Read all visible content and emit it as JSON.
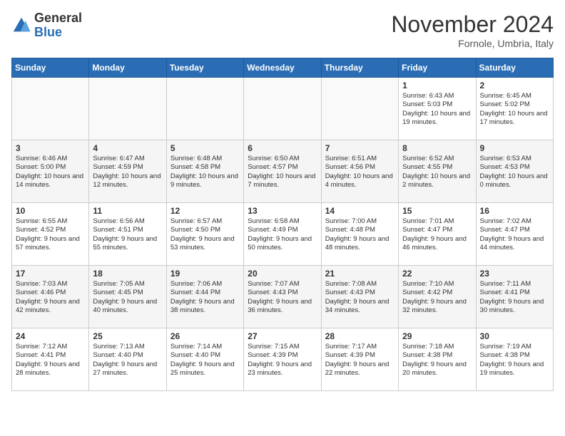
{
  "header": {
    "logo_general": "General",
    "logo_blue": "Blue",
    "month_title": "November 2024",
    "location": "Fornole, Umbria, Italy"
  },
  "days_of_week": [
    "Sunday",
    "Monday",
    "Tuesday",
    "Wednesday",
    "Thursday",
    "Friday",
    "Saturday"
  ],
  "weeks": [
    [
      {
        "day": "",
        "content": ""
      },
      {
        "day": "",
        "content": ""
      },
      {
        "day": "",
        "content": ""
      },
      {
        "day": "",
        "content": ""
      },
      {
        "day": "",
        "content": ""
      },
      {
        "day": "1",
        "content": "Sunrise: 6:43 AM\nSunset: 5:03 PM\nDaylight: 10 hours and 19 minutes."
      },
      {
        "day": "2",
        "content": "Sunrise: 6:45 AM\nSunset: 5:02 PM\nDaylight: 10 hours and 17 minutes."
      }
    ],
    [
      {
        "day": "3",
        "content": "Sunrise: 6:46 AM\nSunset: 5:00 PM\nDaylight: 10 hours and 14 minutes."
      },
      {
        "day": "4",
        "content": "Sunrise: 6:47 AM\nSunset: 4:59 PM\nDaylight: 10 hours and 12 minutes."
      },
      {
        "day": "5",
        "content": "Sunrise: 6:48 AM\nSunset: 4:58 PM\nDaylight: 10 hours and 9 minutes."
      },
      {
        "day": "6",
        "content": "Sunrise: 6:50 AM\nSunset: 4:57 PM\nDaylight: 10 hours and 7 minutes."
      },
      {
        "day": "7",
        "content": "Sunrise: 6:51 AM\nSunset: 4:56 PM\nDaylight: 10 hours and 4 minutes."
      },
      {
        "day": "8",
        "content": "Sunrise: 6:52 AM\nSunset: 4:55 PM\nDaylight: 10 hours and 2 minutes."
      },
      {
        "day": "9",
        "content": "Sunrise: 6:53 AM\nSunset: 4:53 PM\nDaylight: 10 hours and 0 minutes."
      }
    ],
    [
      {
        "day": "10",
        "content": "Sunrise: 6:55 AM\nSunset: 4:52 PM\nDaylight: 9 hours and 57 minutes."
      },
      {
        "day": "11",
        "content": "Sunrise: 6:56 AM\nSunset: 4:51 PM\nDaylight: 9 hours and 55 minutes."
      },
      {
        "day": "12",
        "content": "Sunrise: 6:57 AM\nSunset: 4:50 PM\nDaylight: 9 hours and 53 minutes."
      },
      {
        "day": "13",
        "content": "Sunrise: 6:58 AM\nSunset: 4:49 PM\nDaylight: 9 hours and 50 minutes."
      },
      {
        "day": "14",
        "content": "Sunrise: 7:00 AM\nSunset: 4:48 PM\nDaylight: 9 hours and 48 minutes."
      },
      {
        "day": "15",
        "content": "Sunrise: 7:01 AM\nSunset: 4:47 PM\nDaylight: 9 hours and 46 minutes."
      },
      {
        "day": "16",
        "content": "Sunrise: 7:02 AM\nSunset: 4:47 PM\nDaylight: 9 hours and 44 minutes."
      }
    ],
    [
      {
        "day": "17",
        "content": "Sunrise: 7:03 AM\nSunset: 4:46 PM\nDaylight: 9 hours and 42 minutes."
      },
      {
        "day": "18",
        "content": "Sunrise: 7:05 AM\nSunset: 4:45 PM\nDaylight: 9 hours and 40 minutes."
      },
      {
        "day": "19",
        "content": "Sunrise: 7:06 AM\nSunset: 4:44 PM\nDaylight: 9 hours and 38 minutes."
      },
      {
        "day": "20",
        "content": "Sunrise: 7:07 AM\nSunset: 4:43 PM\nDaylight: 9 hours and 36 minutes."
      },
      {
        "day": "21",
        "content": "Sunrise: 7:08 AM\nSunset: 4:43 PM\nDaylight: 9 hours and 34 minutes."
      },
      {
        "day": "22",
        "content": "Sunrise: 7:10 AM\nSunset: 4:42 PM\nDaylight: 9 hours and 32 minutes."
      },
      {
        "day": "23",
        "content": "Sunrise: 7:11 AM\nSunset: 4:41 PM\nDaylight: 9 hours and 30 minutes."
      }
    ],
    [
      {
        "day": "24",
        "content": "Sunrise: 7:12 AM\nSunset: 4:41 PM\nDaylight: 9 hours and 28 minutes."
      },
      {
        "day": "25",
        "content": "Sunrise: 7:13 AM\nSunset: 4:40 PM\nDaylight: 9 hours and 27 minutes."
      },
      {
        "day": "26",
        "content": "Sunrise: 7:14 AM\nSunset: 4:40 PM\nDaylight: 9 hours and 25 minutes."
      },
      {
        "day": "27",
        "content": "Sunrise: 7:15 AM\nSunset: 4:39 PM\nDaylight: 9 hours and 23 minutes."
      },
      {
        "day": "28",
        "content": "Sunrise: 7:17 AM\nSunset: 4:39 PM\nDaylight: 9 hours and 22 minutes."
      },
      {
        "day": "29",
        "content": "Sunrise: 7:18 AM\nSunset: 4:38 PM\nDaylight: 9 hours and 20 minutes."
      },
      {
        "day": "30",
        "content": "Sunrise: 7:19 AM\nSunset: 4:38 PM\nDaylight: 9 hours and 19 minutes."
      }
    ]
  ]
}
